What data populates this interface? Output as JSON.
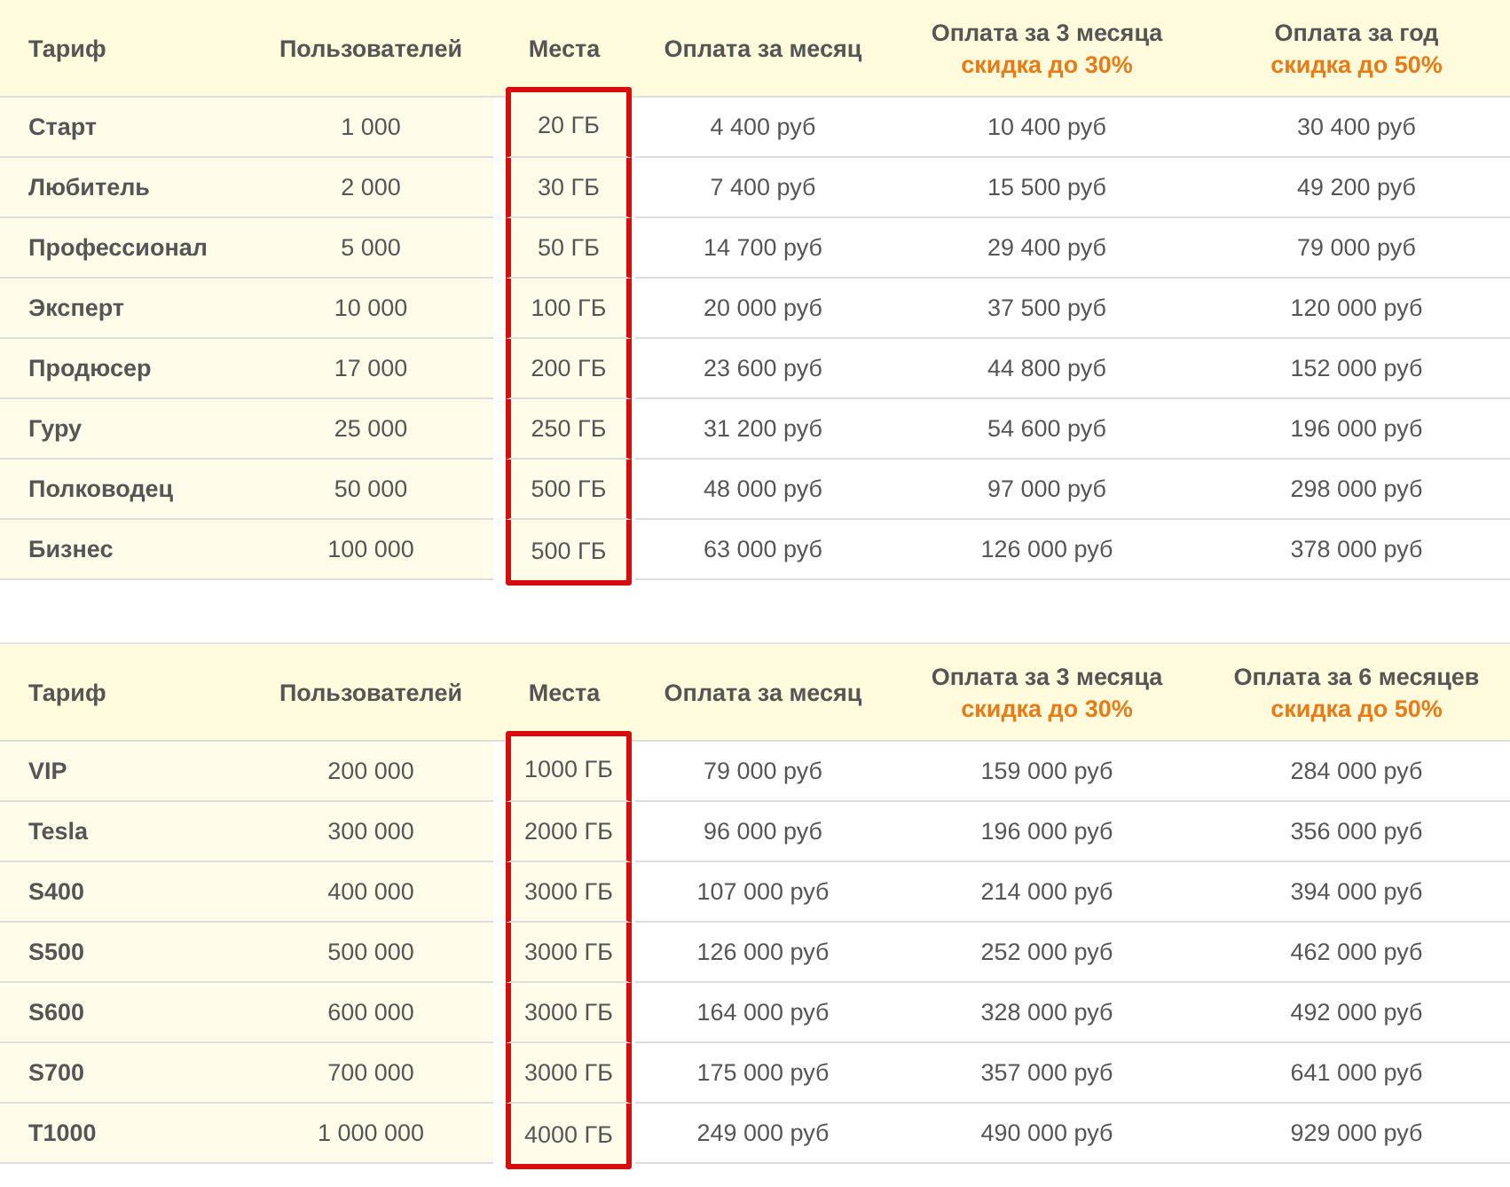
{
  "tables": [
    {
      "columns": [
        {
          "label": "Тариф",
          "highlighted": false
        },
        {
          "label": "Пользователей",
          "highlighted": false
        },
        {
          "label": "Места",
          "highlighted": true
        },
        {
          "label": "Оплата за месяц",
          "highlighted": false
        },
        {
          "label": "Оплата за 3 месяца",
          "note": "скидка до 30%",
          "highlighted": false
        },
        {
          "label": "Оплата за год",
          "note": "скидка до 50%",
          "highlighted": false
        }
      ],
      "rows": [
        [
          "Старт",
          "1 000",
          "20 ГБ",
          "4 400 руб",
          "10 400 руб",
          "30 400 руб"
        ],
        [
          "Любитель",
          "2 000",
          "30 ГБ",
          "7 400 руб",
          "15 500 руб",
          "49 200 руб"
        ],
        [
          "Профессионал",
          "5 000",
          "50 ГБ",
          "14 700 руб",
          "29 400 руб",
          "79 000 руб"
        ],
        [
          "Эксперт",
          "10 000",
          "100 ГБ",
          "20 000 руб",
          "37 500 руб",
          "120 000 руб"
        ],
        [
          "Продюсер",
          "17 000",
          "200 ГБ",
          "23 600 руб",
          "44 800 руб",
          "152 000 руб"
        ],
        [
          "Гуру",
          "25 000",
          "250 ГБ",
          "31 200 руб",
          "54 600 руб",
          "196 000 руб"
        ],
        [
          "Полководец",
          "50 000",
          "500 ГБ",
          "48 000 руб",
          "97 000 руб",
          "298 000 руб"
        ],
        [
          "Бизнес",
          "100 000",
          "500 ГБ",
          "63 000 руб",
          "126 000 руб",
          "378 000 руб"
        ]
      ]
    },
    {
      "columns": [
        {
          "label": "Тариф",
          "highlighted": false
        },
        {
          "label": "Пользователей",
          "highlighted": false
        },
        {
          "label": "Места",
          "highlighted": true
        },
        {
          "label": "Оплата за месяц",
          "highlighted": false
        },
        {
          "label": "Оплата за 3 месяца",
          "note": "скидка до 30%",
          "highlighted": false
        },
        {
          "label": "Оплата за 6 месяцев",
          "note": "скидка до 50%",
          "highlighted": false
        }
      ],
      "rows": [
        [
          "VIP",
          "200 000",
          "1000 ГБ",
          "79 000 руб",
          "159 000 руб",
          "284 000 руб"
        ],
        [
          "Tesla",
          "300 000",
          "2000 ГБ",
          "96 000 руб",
          "196 000 руб",
          "356 000 руб"
        ],
        [
          "S400",
          "400 000",
          "3000 ГБ",
          "107 000 руб",
          "214 000 руб",
          "394 000 руб"
        ],
        [
          "S500",
          "500 000",
          "3000 ГБ",
          "126 000 руб",
          "252 000 руб",
          "462 000 руб"
        ],
        [
          "S600",
          "600 000",
          "3000 ГБ",
          "164 000 руб",
          "328 000 руб",
          "492 000 руб"
        ],
        [
          "S700",
          "700 000",
          "3000 ГБ",
          "175 000 руб",
          "357 000 руб",
          "641 000 руб"
        ],
        [
          "T1000",
          "1 000 000",
          "4000 ГБ",
          "249 000 руб",
          "490 000 руб",
          "929 000 руб"
        ]
      ]
    }
  ]
}
